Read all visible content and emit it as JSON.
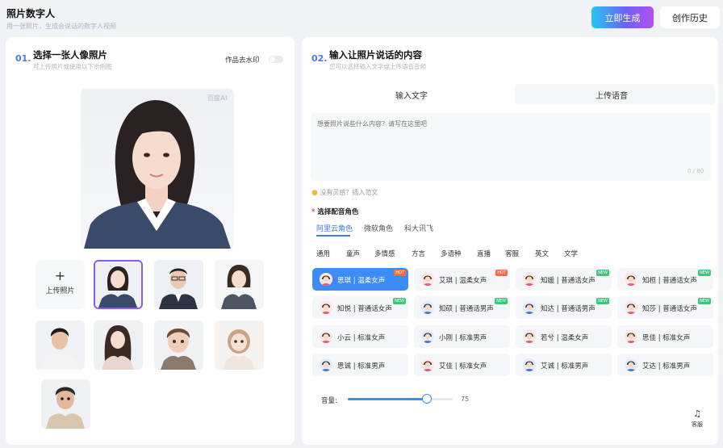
{
  "header": {
    "title": "照片数字人",
    "subtitle": "用一张照片，生成会说话的数字人视频",
    "generate_label": "立即生成",
    "history_label": "创作历史"
  },
  "left": {
    "num": "01.",
    "title": "选择一张人像照片",
    "subtitle": "可上传照片或使用以下示例图",
    "watermark_label": "作品去水印",
    "watermark_on": false,
    "stamp": "百度AI",
    "upload_label": "上传照片",
    "upload_plus": "+"
  },
  "right": {
    "num": "02.",
    "title": "输入让照片说话的内容",
    "subtitle": "您可以选择输入文字或上传语音音频",
    "tabs": [
      "输入文字",
      "上传语音"
    ],
    "placeholder": "想要照片说些什么内容？请写在这里吧",
    "counter": "0 / 80",
    "hint": "没有灵感？插入范文",
    "role_label": "选择配音角色",
    "sources": [
      "阿里云角色",
      "微软角色",
      "科大讯飞"
    ],
    "categories": [
      "通用",
      "童声",
      "多情感",
      "方言",
      "多语种",
      "直播",
      "客服",
      "英文",
      "文学"
    ],
    "voices": [
      {
        "name": "思琪 | 温柔女声",
        "badge": "HOT"
      },
      {
        "name": "艾琪 | 温柔女声",
        "badge": "HOT"
      },
      {
        "name": "知媛 | 普通话女声",
        "badge": "NEW"
      },
      {
        "name": "知桓 | 普通话女声",
        "badge": "NEW"
      },
      {
        "name": "知悦 | 普通话女声",
        "badge": "NEW"
      },
      {
        "name": "知硕 | 普通话男声",
        "badge": "NEW"
      },
      {
        "name": "知达 | 普通话男声",
        "badge": "NEW"
      },
      {
        "name": "知莎 | 普通话女声",
        "badge": "NEW"
      },
      {
        "name": "小云 | 标准女声",
        "badge": ""
      },
      {
        "name": "小刚 | 标准男声",
        "badge": ""
      },
      {
        "name": "若兮 | 温柔女声",
        "badge": ""
      },
      {
        "name": "思佳 | 标准女声",
        "badge": ""
      },
      {
        "name": "思诚 | 标准男声",
        "badge": ""
      },
      {
        "name": "艾佳 | 标准女声",
        "badge": ""
      },
      {
        "name": "艾诚 | 标准男声",
        "badge": ""
      },
      {
        "name": "艾达 | 标准男声",
        "badge": ""
      }
    ],
    "volume_label": "音量:",
    "volume_value": "75",
    "volume": 75,
    "cs_label": "客服"
  },
  "colors": {
    "accent": "#3d8bf5",
    "select": "#8a5cf6"
  }
}
